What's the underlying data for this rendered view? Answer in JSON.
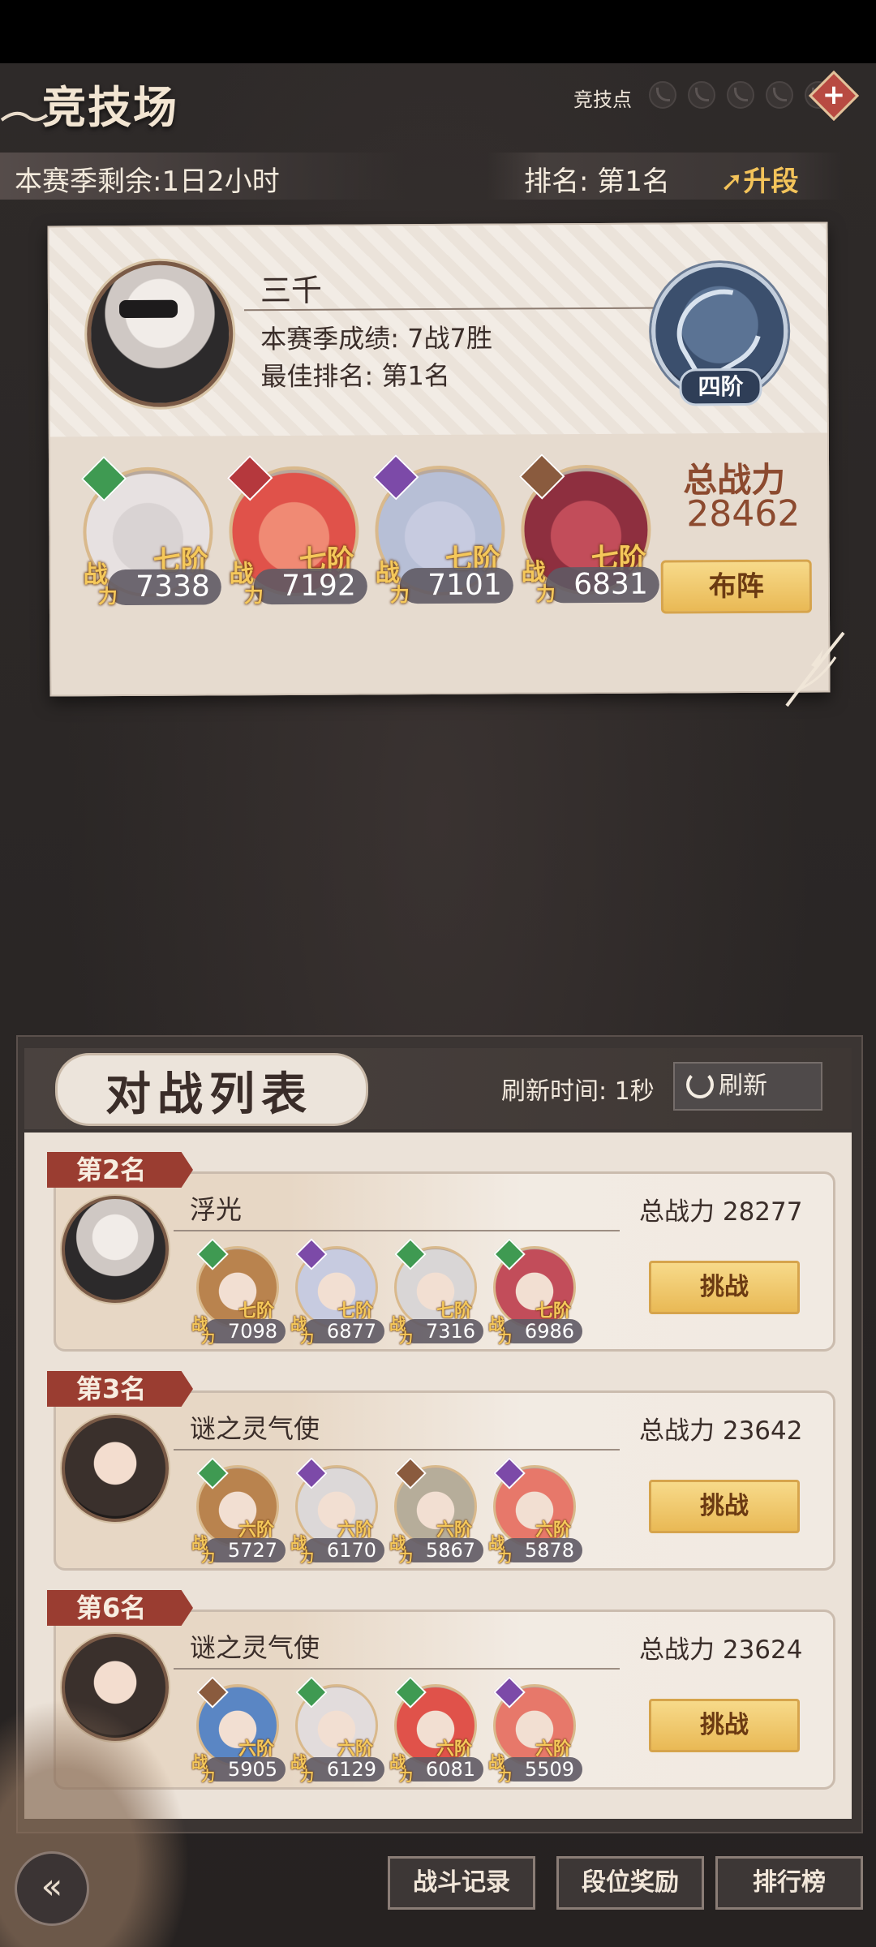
{
  "header": {
    "title": "竞技场",
    "points_label": "竞技点",
    "points_icons": [
      "point-empty-icon",
      "point-empty-icon",
      "point-empty-icon",
      "point-empty-icon",
      "point-empty-icon"
    ],
    "season_remaining": "本赛季剩余:1日2小时",
    "rank": "排名: 第1名",
    "upgrade": "升段"
  },
  "profile": {
    "name": "三千",
    "season_record": "本赛季成绩: 7战7胜",
    "best_rank": "最佳排名: 第1名",
    "tier": "四阶",
    "total_power_label": "总战力",
    "total_power": "28462",
    "deploy_label": "布阵",
    "heroes": [
      {
        "rank": "七阶",
        "power": "7338",
        "zhan": "战",
        "li": "力",
        "elem_color": "#3f9a52",
        "portrait": "#d9d3d3",
        "hair": "#e7e1e1"
      },
      {
        "rank": "七阶",
        "power": "7192",
        "zhan": "战",
        "li": "力",
        "elem_color": "#b5383d",
        "portrait": "#f08a74",
        "hair": "#e0524a"
      },
      {
        "rank": "七阶",
        "power": "7101",
        "zhan": "战",
        "li": "力",
        "elem_color": "#7c4aa8",
        "portrait": "#c7cbe0",
        "hair": "#b7bfd6"
      },
      {
        "rank": "七阶",
        "power": "6831",
        "zhan": "战",
        "li": "力",
        "elem_color": "#8a5b3e",
        "portrait": "#c24d5a",
        "hair": "#8e2f3f"
      }
    ]
  },
  "battle_list": {
    "title": "对战列表",
    "refresh_time": "刷新时间: 1秒",
    "refresh_label": "刷新",
    "entries": [
      {
        "rank_tag": "第2名",
        "name": "浮光",
        "total": "总战力 28277",
        "challenge": "挑战",
        "avatar": "light",
        "heroes": [
          {
            "rank": "七阶",
            "power": "7098",
            "elem_color": "#3f9a52",
            "portrait": "#b9834e"
          },
          {
            "rank": "七阶",
            "power": "6877",
            "elem_color": "#7c4aa8",
            "portrait": "#c7cbe0"
          },
          {
            "rank": "七阶",
            "power": "7316",
            "elem_color": "#3f9a52",
            "portrait": "#d9d6d6"
          },
          {
            "rank": "七阶",
            "power": "6986",
            "elem_color": "#3f9a52",
            "portrait": "#c24d5a"
          }
        ]
      },
      {
        "rank_tag": "第3名",
        "name": "谜之灵气使",
        "total": "总战力 23642",
        "challenge": "挑战",
        "avatar": "dark",
        "heroes": [
          {
            "rank": "六阶",
            "power": "5727",
            "elem_color": "#3f9a52",
            "portrait": "#b9834e"
          },
          {
            "rank": "六阶",
            "power": "6170",
            "elem_color": "#7c4aa8",
            "portrait": "#dcd8d8"
          },
          {
            "rank": "六阶",
            "power": "5867",
            "elem_color": "#8a5b3e",
            "portrait": "#b6ad9a"
          },
          {
            "rank": "六阶",
            "power": "5878",
            "elem_color": "#7c4aa8",
            "portrait": "#e7786a"
          }
        ]
      },
      {
        "rank_tag": "第6名",
        "name": "谜之灵气使",
        "total": "总战力 23624",
        "challenge": "挑战",
        "avatar": "dark",
        "heroes": [
          {
            "rank": "六阶",
            "power": "5905",
            "elem_color": "#8a5b3e",
            "portrait": "#5a86c4"
          },
          {
            "rank": "六阶",
            "power": "6129",
            "elem_color": "#3f9a52",
            "portrait": "#e2dcdc"
          },
          {
            "rank": "六阶",
            "power": "6081",
            "elem_color": "#3f9a52",
            "portrait": "#e0524a"
          },
          {
            "rank": "六阶",
            "power": "5509",
            "elem_color": "#7c4aa8",
            "portrait": "#e7786a"
          }
        ]
      }
    ],
    "zhan": "战",
    "li": "力"
  },
  "bottom_nav": {
    "back_icon": "back-arrow-icon",
    "buttons": [
      "战斗记录",
      "段位奖励",
      "排行榜"
    ]
  }
}
